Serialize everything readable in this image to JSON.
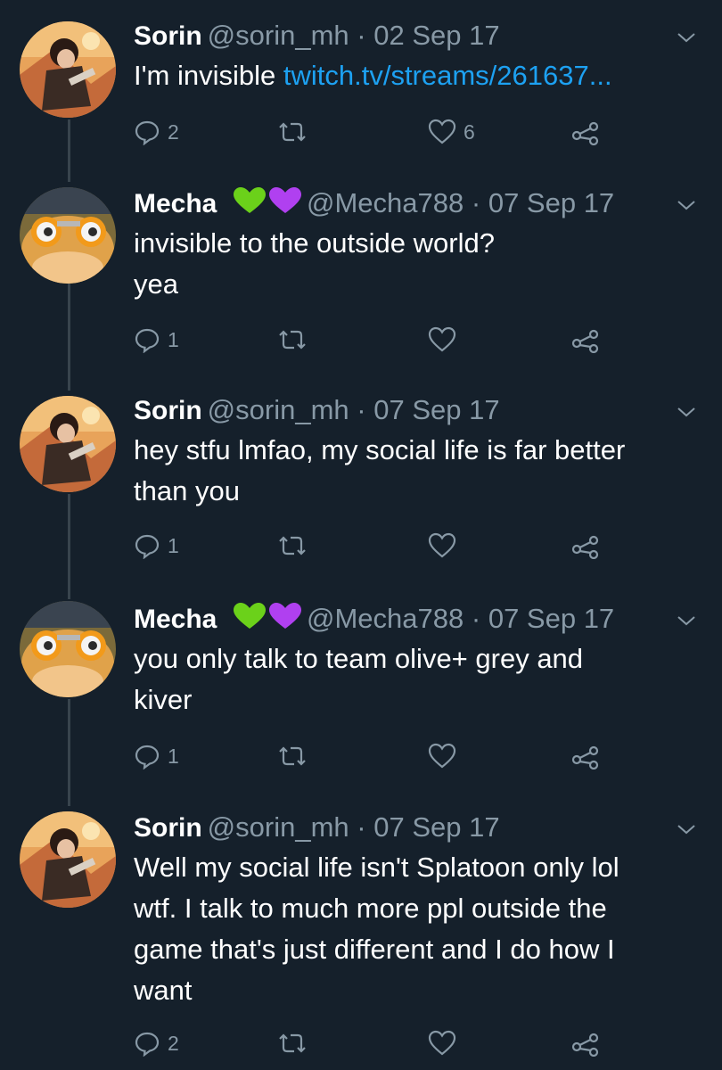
{
  "thread": [
    {
      "name": "Sorin",
      "handle": "@sorin_mh",
      "dot": "·",
      "date": "02 Sep 17",
      "text": "I'm invisible ",
      "link": "twitch.tv/streams/261637...",
      "line2": "",
      "replies": "2",
      "likes": "6",
      "avatar": "sorin"
    },
    {
      "name": "Mecha",
      "handle": "@Mecha788",
      "dot": "·",
      "date": "07 Sep 17",
      "text": "invisible to the outside world?",
      "line2": "yea",
      "replies": "1",
      "likes": "",
      "avatar": "mecha"
    },
    {
      "name": "Sorin",
      "handle": "@sorin_mh",
      "dot": "·",
      "date": "07 Sep 17",
      "text": "hey stfu lmfao, my social life is far better",
      "line2": "than you",
      "replies": "1",
      "likes": "",
      "avatar": "sorin"
    },
    {
      "name": "Mecha",
      "handle": "@Mecha788",
      "dot": "·",
      "date": "07 Sep 17",
      "text": "you only talk to team olive+ grey and",
      "line2": "kiver",
      "replies": "1",
      "likes": "",
      "avatar": "mecha"
    },
    {
      "name": "Sorin",
      "handle": "@sorin_mh",
      "dot": "·",
      "date": "07 Sep 17",
      "text": "Well my social life isn't Splatoon only lol",
      "line2": "wtf. I talk to much more ppl outside the",
      "line3": "game that's just different and I do how I",
      "line4": "want",
      "replies": "2",
      "likes": "",
      "avatar": "sorin"
    }
  ],
  "colors": {
    "background": "#15202b",
    "secondary_text": "#8899a6",
    "link": "#1da1f2",
    "green_heart": "#6bd11a",
    "purple_heart": "#b040f0"
  },
  "icons": {
    "reply": "reply-icon",
    "retweet": "retweet-icon",
    "like": "heart-icon",
    "share": "share-icon",
    "caret": "chevron-down-icon"
  }
}
